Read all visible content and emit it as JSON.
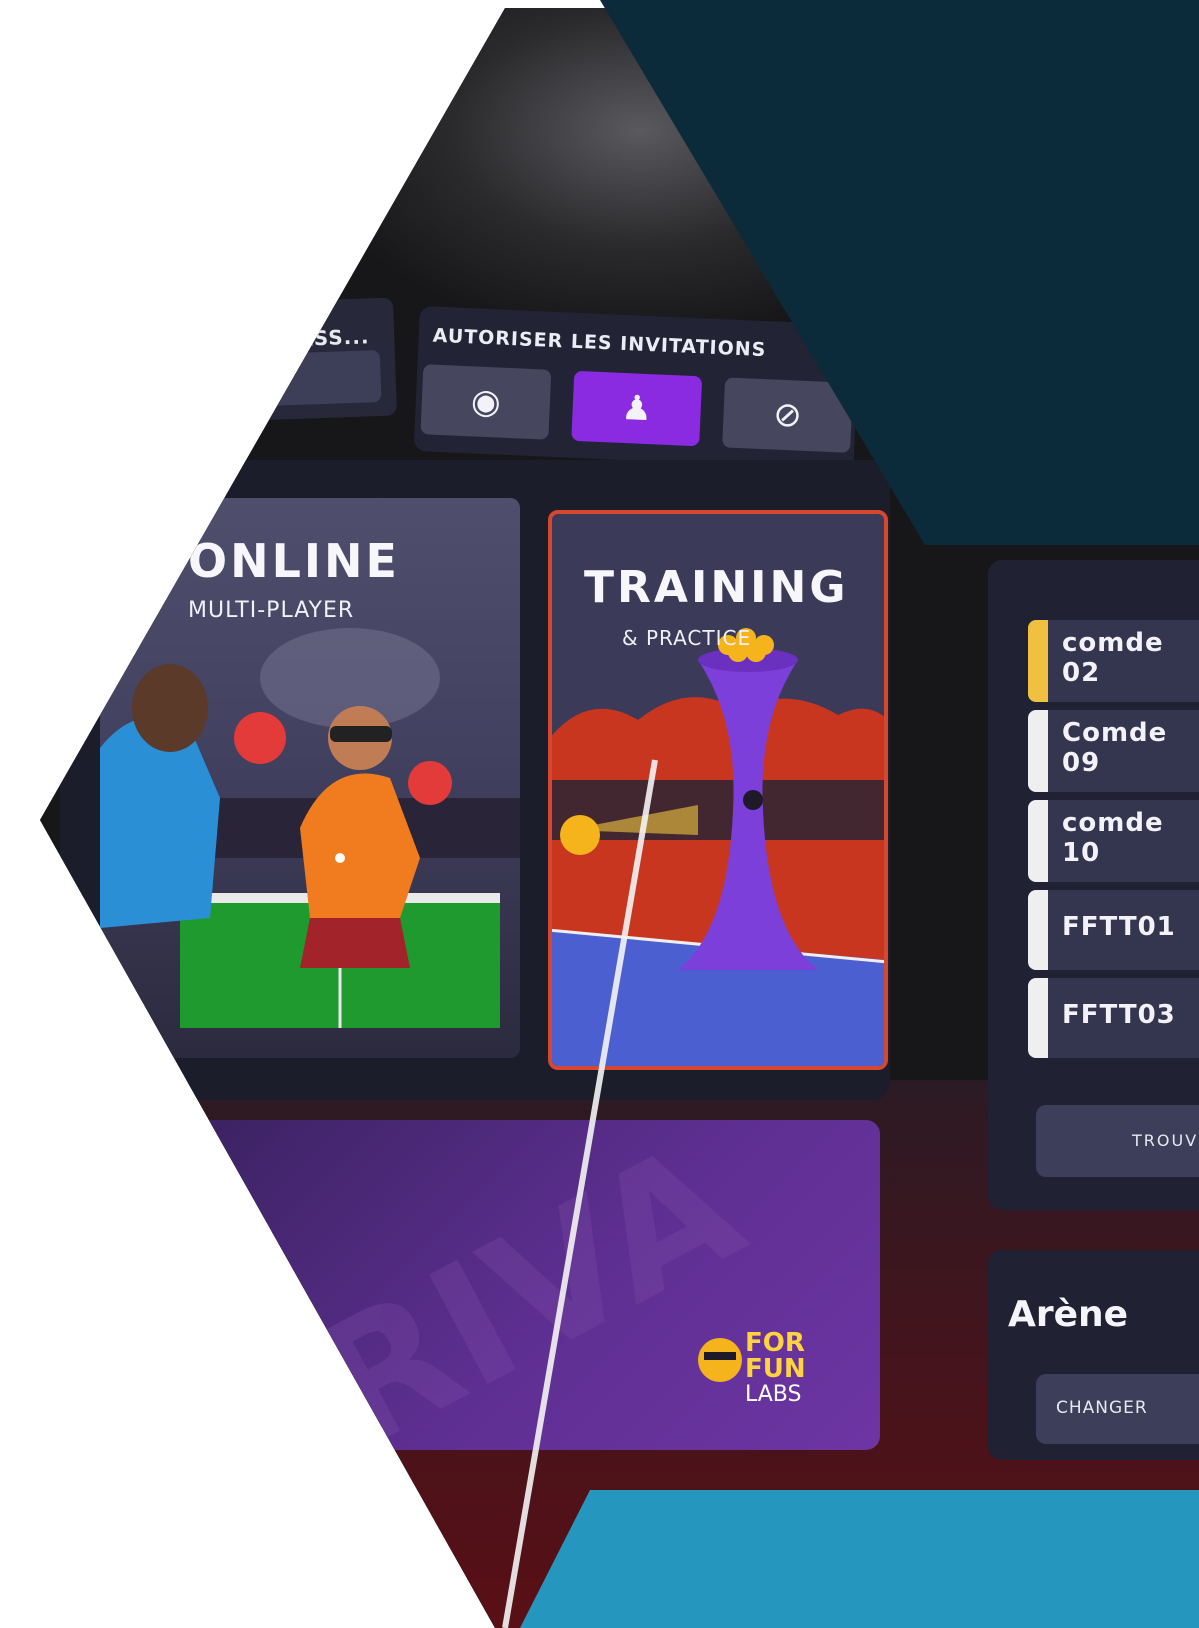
{
  "top_panel": {
    "label": "ASS..."
  },
  "invitations": {
    "title": "AUTORISER LES INVITATIONS",
    "options": [
      {
        "icon": "globe-icon",
        "glyph": "◉",
        "active": false
      },
      {
        "icon": "friends-icon",
        "glyph": "♟",
        "active": true
      },
      {
        "icon": "block-icon",
        "glyph": "⊘",
        "active": false
      }
    ],
    "active_color": "#8a2be2"
  },
  "modes": {
    "online": {
      "title": "ONLINE",
      "subtitle": "MULTI-PLAYER"
    },
    "training": {
      "title": "TRAINING",
      "subtitle": "& PRACTICE",
      "border_color": "#d5472f"
    }
  },
  "banner": {
    "brand_line1": "FOR",
    "brand_line2": "FUN",
    "brand_line3": "LABS"
  },
  "player_list": {
    "items": [
      {
        "line1": "comde",
        "line2": "02",
        "marker": "gold"
      },
      {
        "line1": "Comde",
        "line2": "09",
        "marker": "white"
      },
      {
        "line1": "comde",
        "line2": "10",
        "marker": "white"
      },
      {
        "line1": "FFTT01",
        "line2": "",
        "marker": "white"
      },
      {
        "line1": "FFTT03",
        "line2": "",
        "marker": "white"
      }
    ],
    "find_button": "TROUV"
  },
  "arena": {
    "title": "Arène",
    "change_button": "CHANGER"
  },
  "colors": {
    "overlay_dark": "#0b2b3a",
    "overlay_teal": "#2597bf",
    "banner_purple": "#5e2f92"
  }
}
